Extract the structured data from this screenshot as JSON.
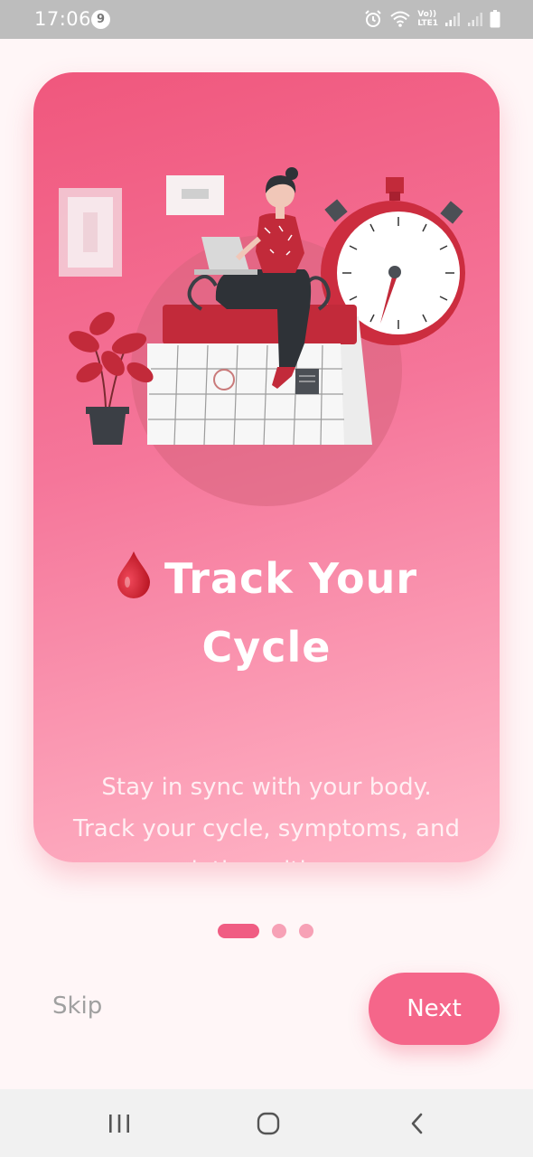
{
  "status_bar": {
    "time": "17:06",
    "notification_count": "9",
    "icons": [
      "alarm-icon",
      "wifi-icon",
      "volte-icon",
      "signal-icon",
      "signal-icon",
      "battery-icon"
    ],
    "network_label_top": "Vo))",
    "network_label_bottom": "LTE1"
  },
  "onboarding": {
    "title_emoji": "drop-icon",
    "title": "Track Your Cycle",
    "subtitle": "Stay in sync with your body. Track your cycle, symptoms, and ovulation with ease.",
    "page_index": 0,
    "page_count": 3
  },
  "actions": {
    "skip_label": "Skip",
    "next_label": "Next"
  },
  "nav_bar": {
    "buttons": [
      "recents-icon",
      "home-icon",
      "back-icon"
    ]
  },
  "colors": {
    "card_top": "#f0577d",
    "card_bottom": "#ffb6c7",
    "accent": "#f5668a",
    "background": "#fff6f7"
  }
}
